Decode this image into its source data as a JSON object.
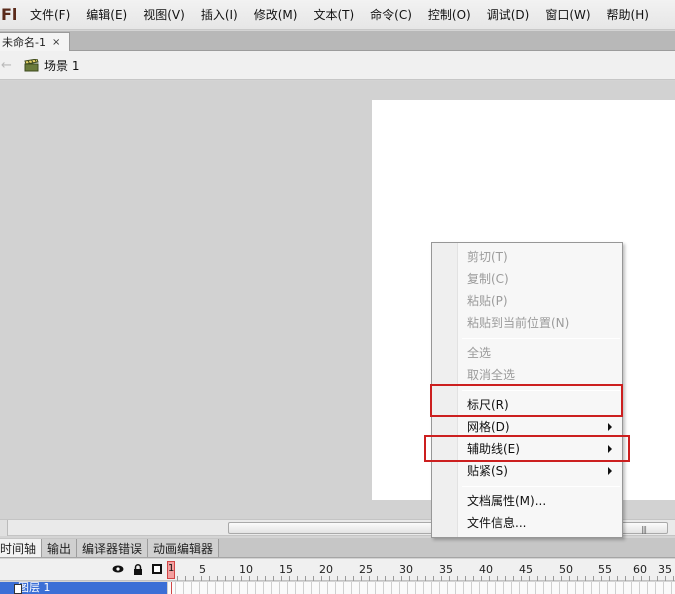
{
  "app": {
    "logo": "Fl"
  },
  "menubar": {
    "items": [
      "文件(F)",
      "编辑(E)",
      "视图(V)",
      "插入(I)",
      "修改(M)",
      "文本(T)",
      "命令(C)",
      "控制(O)",
      "调试(D)",
      "窗口(W)",
      "帮助(H)"
    ]
  },
  "document_tab": {
    "title": "未命名-1",
    "close": "×"
  },
  "editbar": {
    "back_icon": "arrow-left-icon",
    "scene_icon": "clapperboard-icon",
    "scene_label": "场景 1"
  },
  "panel_tabs": [
    "时间轴",
    "输出",
    "编译器错误",
    "动画编辑器"
  ],
  "timeline": {
    "header_icons": [
      "eye-icon",
      "lock-icon",
      "outline-square-icon"
    ],
    "current_frame": "1",
    "frame_numbers": [
      "5",
      "10",
      "15",
      "20",
      "25",
      "30",
      "35",
      "40",
      "45",
      "50",
      "55",
      "60",
      "35",
      "40"
    ],
    "layer_name": "图层 1"
  },
  "context_menu": {
    "items": [
      {
        "label": "剪切(T)",
        "disabled": true,
        "submenu": false
      },
      {
        "label": "复制(C)",
        "disabled": true,
        "submenu": false
      },
      {
        "label": "粘贴(P)",
        "disabled": true,
        "submenu": false
      },
      {
        "label": "粘贴到当前位置(N)",
        "disabled": true,
        "submenu": false
      },
      {
        "label": "全选",
        "disabled": true,
        "submenu": false
      },
      {
        "label": "取消全选",
        "disabled": true,
        "submenu": false
      },
      {
        "label": "标尺(R)",
        "disabled": false,
        "submenu": false
      },
      {
        "label": "网格(D)",
        "disabled": false,
        "submenu": true
      },
      {
        "label": "辅助线(E)",
        "disabled": false,
        "submenu": true
      },
      {
        "label": "贴紧(S)",
        "disabled": false,
        "submenu": true
      },
      {
        "label": "文档属性(M)...",
        "disabled": false,
        "submenu": false
      },
      {
        "label": "文件信息...",
        "disabled": false,
        "submenu": false
      }
    ]
  },
  "colors": {
    "highlight_box": "#cc1f1f",
    "layer_selected": "#3b6fd6",
    "playhead": "#d04545"
  }
}
